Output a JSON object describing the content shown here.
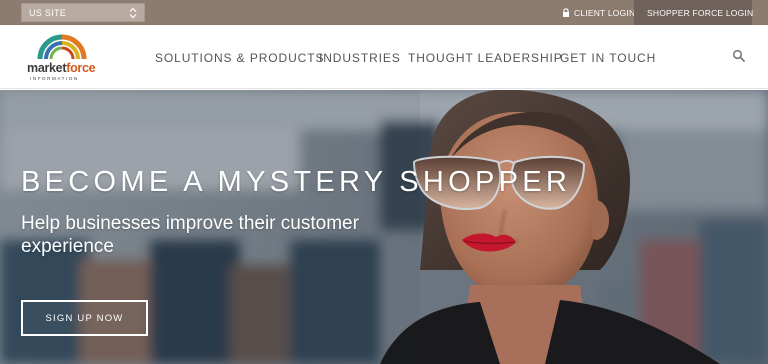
{
  "topbar": {
    "site_select": {
      "value": "US SITE"
    },
    "client_login_label": "CLIENT LOGIN",
    "shopper_login_label": "SHOPPER FORCE LOGIN"
  },
  "brand": {
    "name_part1": "market",
    "name_part2": "force",
    "tagline": "INFORMATION",
    "colors": [
      "#2a9a8a",
      "#3a6fb0",
      "#e07b22",
      "#d9b21c",
      "#c9471f"
    ]
  },
  "nav": {
    "items": [
      {
        "label": "SOLUTIONS & PRODUCTS"
      },
      {
        "label": "INDUSTRIES"
      },
      {
        "label": "THOUGHT LEADERSHIP"
      },
      {
        "label": "GET IN TOUCH"
      }
    ],
    "search_icon": "search-icon"
  },
  "hero": {
    "title": "BECOME A MYSTERY SHOPPER",
    "subtitle": "Help businesses improve their customer experience",
    "cta_label": "SIGN UP NOW"
  }
}
